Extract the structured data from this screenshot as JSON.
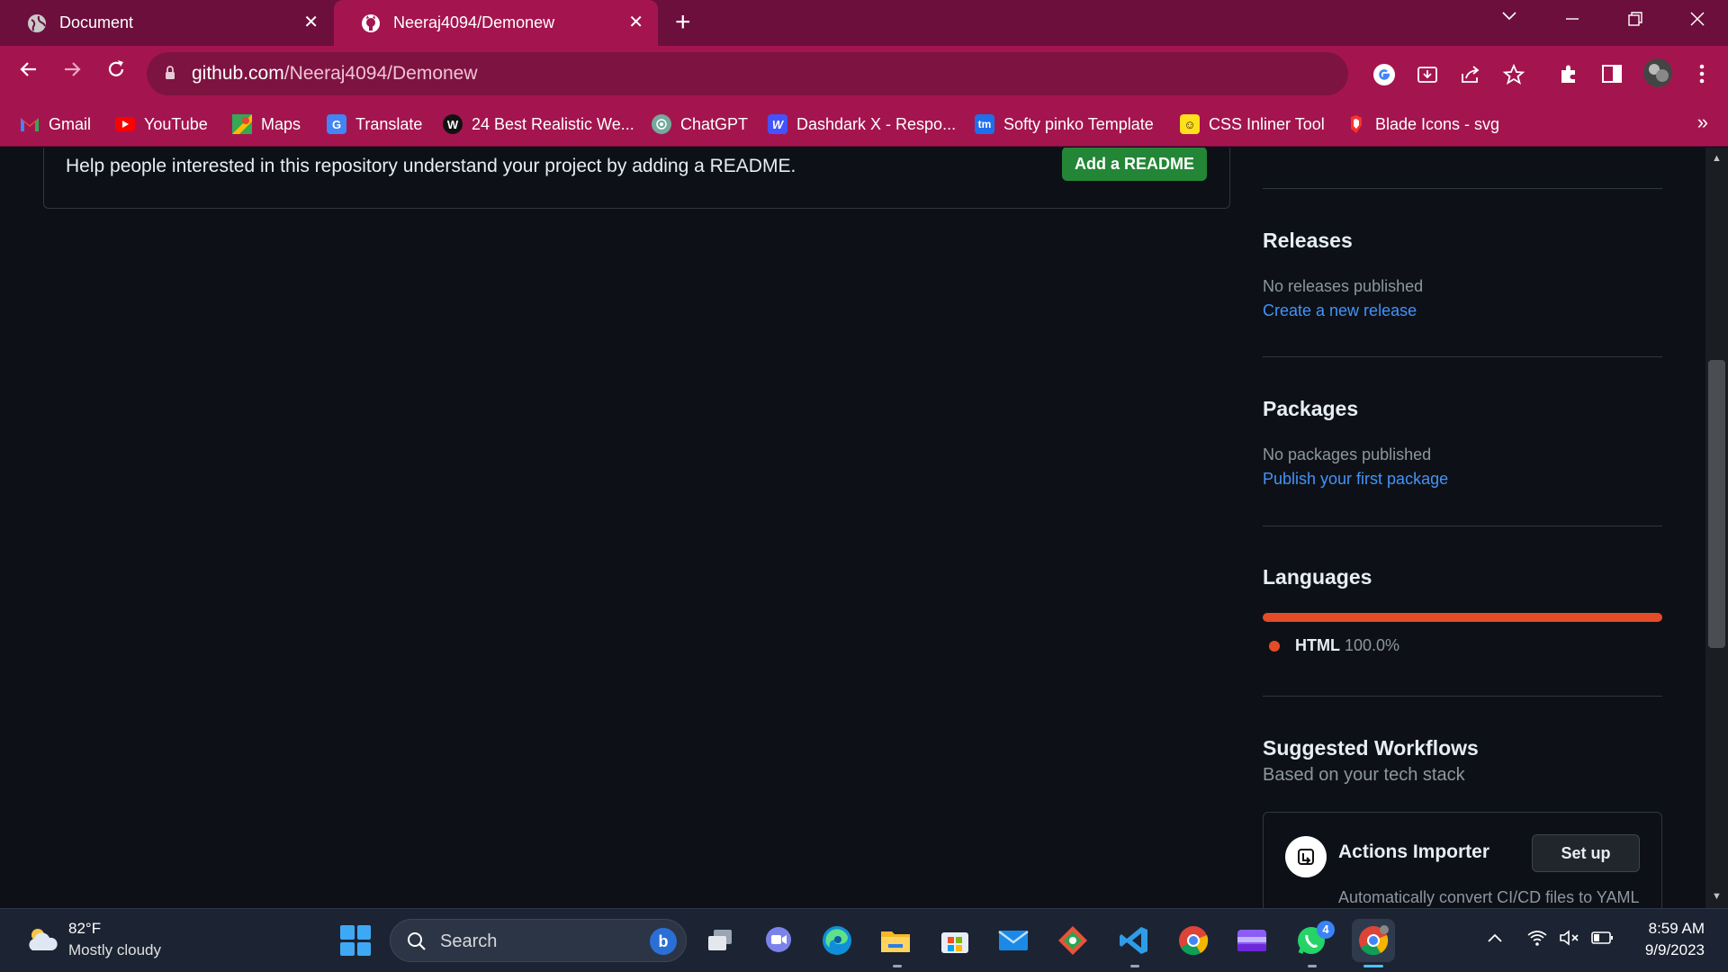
{
  "browser": {
    "tabs": [
      {
        "title": "Document"
      },
      {
        "title": "Neeraj4094/Demonew"
      }
    ],
    "close_glyph": "✕",
    "new_tab_glyph": "+",
    "url_host": "github.com",
    "url_path": "/Neeraj4094/Demonew",
    "bookmarks": [
      {
        "label": "Gmail",
        "icon": "gmail-icon"
      },
      {
        "label": "YouTube",
        "icon": "youtube-icon"
      },
      {
        "label": "Maps",
        "icon": "maps-icon"
      },
      {
        "label": "Translate",
        "icon": "translate-icon"
      },
      {
        "label": "24 Best Realistic We...",
        "icon": "w-icon"
      },
      {
        "label": "ChatGPT",
        "icon": "chatgpt-icon"
      },
      {
        "label": "Dashdark X - Respo...",
        "icon": "webflow-icon"
      },
      {
        "label": "Softy pinko Template",
        "icon": "tm-icon"
      },
      {
        "label": "CSS Inliner Tool",
        "icon": "mailchimp-icon"
      },
      {
        "label": "Blade Icons - svg",
        "icon": "laravel-icon"
      }
    ],
    "bookmarks_more": "»",
    "colors": {
      "frame": "#6c0f3c",
      "toolbar": "#a4154f"
    }
  },
  "repo": {
    "readme_prompt": "Help people interested in this repository understand your project by adding a README.",
    "add_readme_label": "Add a README"
  },
  "sidebar": {
    "releases": {
      "title": "Releases",
      "empty": "No releases published",
      "link": "Create a new release"
    },
    "packages": {
      "title": "Packages",
      "empty": "No packages published",
      "link": "Publish your first package"
    },
    "languages": {
      "title": "Languages",
      "items": [
        {
          "name": "HTML",
          "percent": "100.0%",
          "color": "#e34c26"
        }
      ]
    },
    "workflows": {
      "title": "Suggested Workflows",
      "subtitle": "Based on your tech stack",
      "card": {
        "name": "Actions Importer",
        "button": "Set up",
        "description": "Automatically convert CI/CD files to YAML"
      }
    }
  },
  "taskbar": {
    "weather_temp": "82°F",
    "weather_desc": "Mostly cloudy",
    "search_placeholder": "Search",
    "bing_label": "b",
    "whatsapp_badge": "4",
    "time": "8:59 AM",
    "date": "9/9/2023"
  }
}
